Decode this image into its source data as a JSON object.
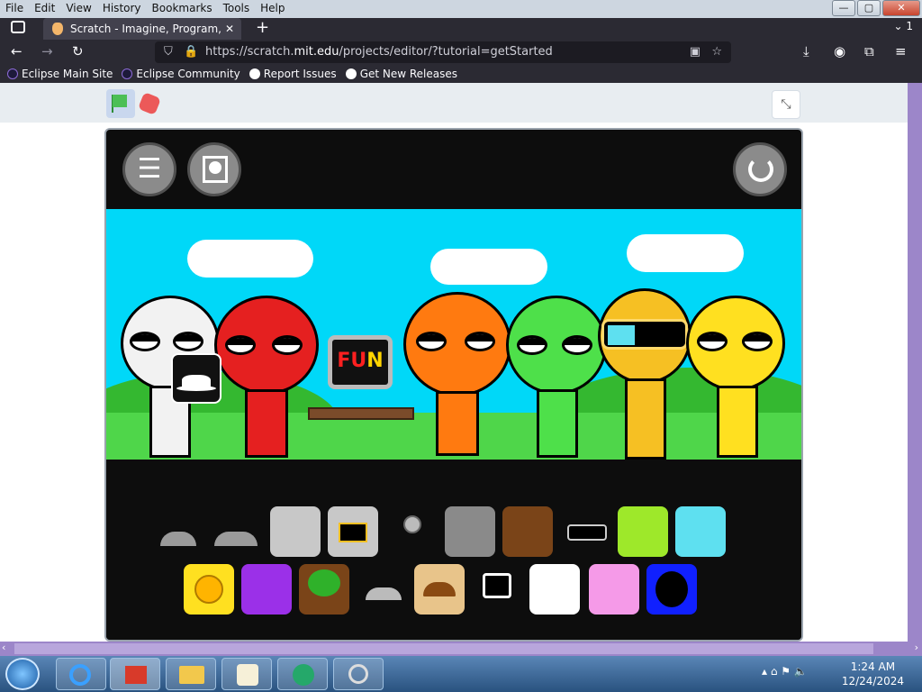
{
  "menu": [
    "File",
    "Edit",
    "View",
    "History",
    "Bookmarks",
    "Tools",
    "Help"
  ],
  "window_controls": {
    "minimize": "—",
    "maximize": "▢",
    "close": "✕"
  },
  "tab": {
    "title": "Scratch - Imagine, Program, Sha",
    "close": "✕",
    "new_tab": "+",
    "tab_count": "1"
  },
  "url": {
    "prefix": "https://scratch.",
    "domain": "mit.edu",
    "suffix": "/projects/editor/?tutorial=getStarted"
  },
  "bookmarks": [
    "Eclipse Main Site",
    "Eclipse Community",
    "Report Issues",
    "Get New Releases"
  ],
  "stage": {
    "fun_text_a": "FU",
    "fun_text_b": "N",
    "menu_glyph": "☰"
  },
  "clock": {
    "time": "1:24 AM",
    "date": "12/24/2024"
  },
  "colors": {
    "sky": "#00d8f8",
    "grass": "#4fd64a",
    "stage_bg": "#0d0d0d",
    "taskbar": "#29527f",
    "scrollbar": "#9c86c9"
  },
  "icons": [
    "green-flag-icon",
    "stop-icon",
    "fullscreen-exit-icon",
    "menu-icon",
    "portrait-icon",
    "reset-icon",
    "hat-icon"
  ]
}
